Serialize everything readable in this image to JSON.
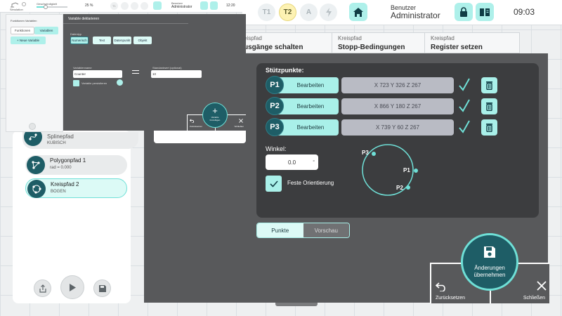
{
  "topbar": {
    "t1": "T1",
    "t2": "T2",
    "a": "A",
    "user_label": "Benutzer",
    "user_name": "Administrator",
    "clock": "09:03"
  },
  "tabs": [
    {
      "sub": "eispfad",
      "main": "usgänge schalten"
    },
    {
      "sub": "Kreispfad",
      "main": "Stopp-Bedingungen"
    },
    {
      "sub": "Kreispfad",
      "main": "Register setzen"
    }
  ],
  "editor": {
    "points_label": "Stützpunkte:",
    "points": [
      {
        "id": "P1",
        "edit": "Bearbeiten",
        "coords": "X 723 Y 326 Z 267"
      },
      {
        "id": "P2",
        "edit": "Bearbeiten",
        "coords": "X 866 Y 180 Z 267"
      },
      {
        "id": "P3",
        "edit": "Bearbeiten",
        "coords": "X 739 Y 60 Z 267"
      }
    ],
    "angle_label": "Winkel:",
    "angle_value": "0.0",
    "fixed_orientation": "Feste Orientierung",
    "diagram": {
      "p1": "P1",
      "p2": "P2",
      "p3": "P3"
    },
    "view_toggle": {
      "points": "Punkte",
      "preview": "Vorschau"
    }
  },
  "actions": {
    "reset": "Zurücksetzen",
    "save_line1": "Änderungen",
    "save_line2": "übernehmen",
    "close": "Schließen"
  },
  "path_list": [
    {
      "name": "Splinepfad",
      "sub": "KUBISCH"
    },
    {
      "name": "Polygonpfad 1",
      "sub": "rad = 0.000"
    },
    {
      "name": "Kreispfad 2",
      "sub": "BOGEN"
    }
  ],
  "overlay": {
    "topbar": {
      "mode_label": "Simulation",
      "speed_label": "Geschwindigkeit",
      "speed_value": "25 %",
      "t1": "T1",
      "t2": "T2",
      "user_label": "Benutzer",
      "user_name": "Administrator",
      "clock": "12:20"
    },
    "sidebar": {
      "title": "Funktionen Variablen",
      "tab_functions": "Funktionen",
      "tab_variables": "Variablen",
      "new_variable": "+ Neue Variable"
    },
    "dialog": {
      "title": "Variable deklarieren",
      "type_label": "Datentyp",
      "types": [
        "Numerisch",
        "Text",
        "Datenpunkt",
        "Objekt"
      ],
      "name_label": "Variablenname",
      "name_value": "Counter",
      "default_label": "Standardwert (optional)",
      "default_value": "10",
      "persist_label": "Variable persistieren",
      "reset_label": "Zurücksetzen",
      "add_label": "Variable hinzufügen",
      "close_label": "Schließen"
    }
  }
}
